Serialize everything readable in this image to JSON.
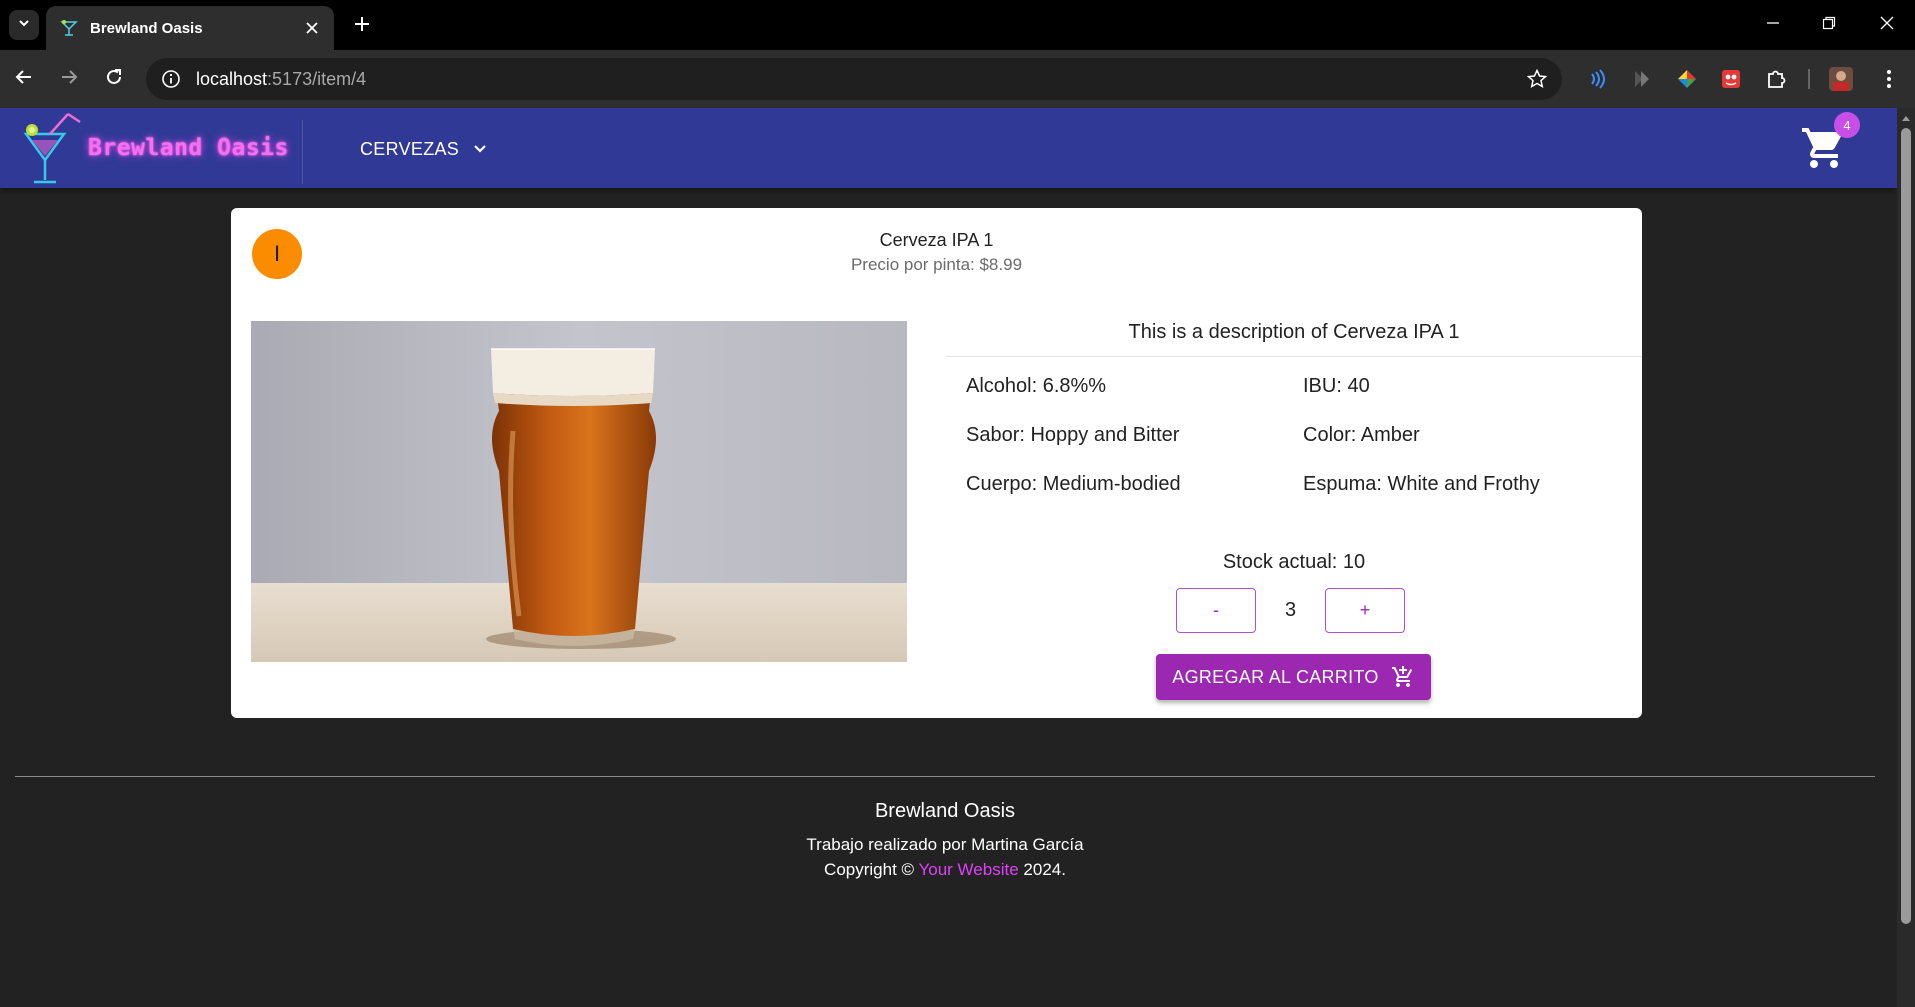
{
  "browser": {
    "tab_title": "Brewland Oasis",
    "url_host": "localhost",
    "url_path": ":5173/item/4"
  },
  "icons": {
    "tab_menu": "chevron-down-icon",
    "tab_close": "close-icon",
    "new_tab": "plus-icon",
    "back": "arrow-left-icon",
    "forward": "arrow-right-icon",
    "reload": "reload-icon",
    "site_info": "info-icon",
    "bookmark": "star-icon",
    "cart": "shopping-cart-icon",
    "add_to_cart": "add-shopping-cart-icon"
  },
  "appbar": {
    "brand": "Brewland Oasis",
    "menu_label": "CERVEZAS",
    "cart_count": "4"
  },
  "product": {
    "avatar_letter": "I",
    "title": "Cerveza IPA 1",
    "price": "Precio por pinta: $8.99",
    "description": "This is a description of Cerveza IPA 1",
    "attributes": [
      "Alcohol: 6.8%%",
      "IBU: 40",
      "Sabor: Hoppy and Bitter",
      "Color: Amber",
      "Cuerpo: Medium-bodied",
      "Espuma: White and Frothy"
    ],
    "stock": "Stock actual: 10",
    "quantity": "3",
    "minus_label": "-",
    "plus_label": "+",
    "add_to_cart_label": "AGREGAR AL CARRITO"
  },
  "footer": {
    "brand": "Brewland Oasis",
    "credit": "Trabajo realizado por Martina García",
    "copyright_prefix": "Copyright ©",
    "copyright_link": "Your Website",
    "copyright_year": "2024."
  },
  "colors": {
    "appbar": "#303996",
    "brand_neon": "#f56ff0",
    "accent_purple": "#9c27b0",
    "avatar_orange": "#fb8c00",
    "page_bg": "#222222"
  }
}
